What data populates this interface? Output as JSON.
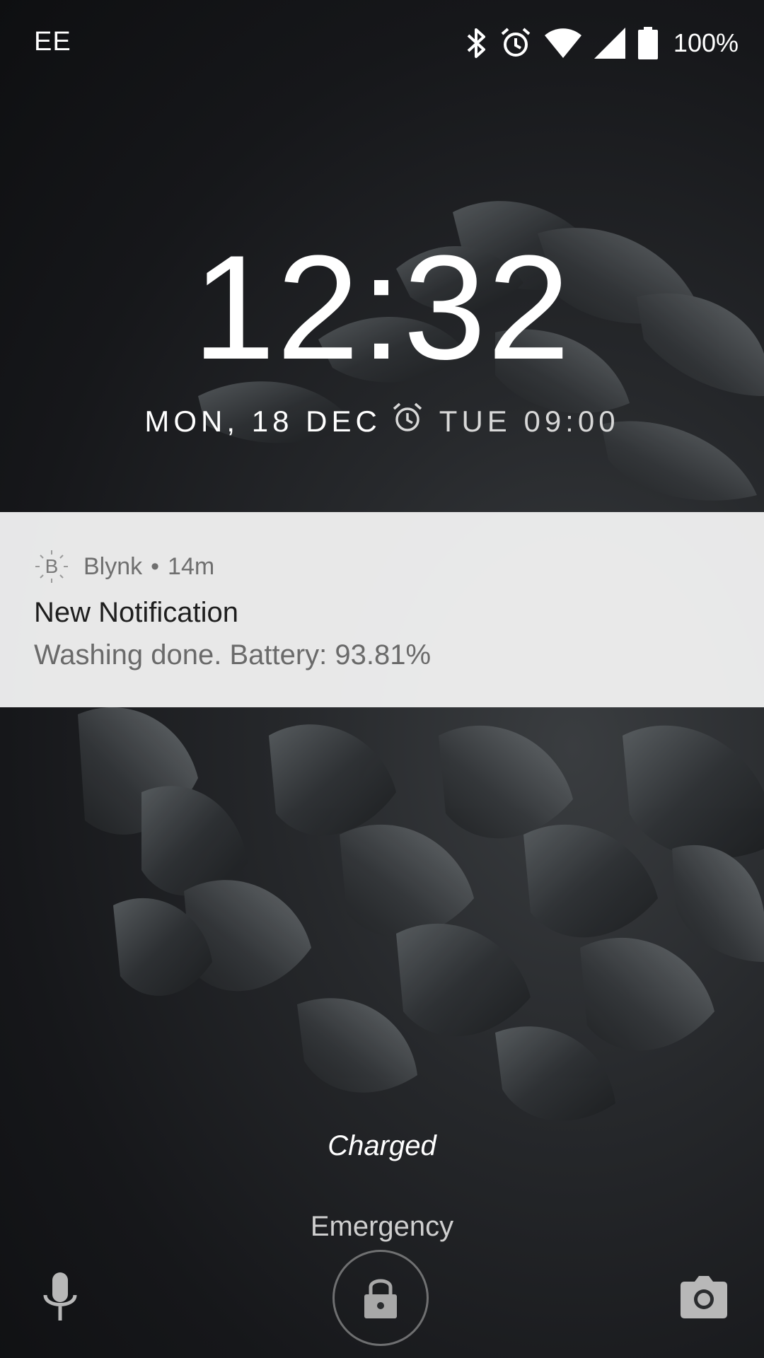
{
  "status_bar": {
    "carrier": "EE",
    "battery_percent": "100%",
    "icons": [
      "bluetooth-icon",
      "alarm-icon",
      "wifi-icon",
      "cell-signal-icon",
      "battery-icon"
    ]
  },
  "lockscreen": {
    "time": "12:32",
    "date": "MON, 18 DEC",
    "next_alarm": "TUE 09:00"
  },
  "notification": {
    "app_name": "Blynk",
    "app_icon_letter": "B",
    "separator": "•",
    "age": "14m",
    "title": "New Notification",
    "body": "Washing done. Battery: 93.81%"
  },
  "bottom": {
    "charge_status": "Charged",
    "emergency_label": "Emergency",
    "left_icon": "microphone-icon",
    "center_icon": "lock-icon",
    "right_icon": "camera-icon"
  },
  "colors": {
    "notification_bg": "#f0f0f0",
    "text_primary": "#ffffff",
    "notif_title": "#1e1e1e",
    "notif_body": "#6a6a6a"
  }
}
